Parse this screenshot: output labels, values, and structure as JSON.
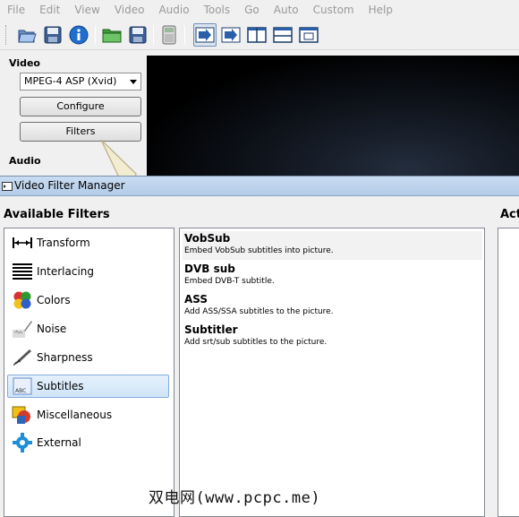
{
  "menu": [
    "File",
    "Edit",
    "View",
    "Video",
    "Audio",
    "Tools",
    "Go",
    "Auto",
    "Custom",
    "Help"
  ],
  "toolbar": {
    "icons": [
      "open-file-icon",
      "save-icon",
      "info-icon",
      "open-folder-icon",
      "save-as-icon",
      "calculator-icon",
      "play-filtered-icon",
      "next-frame-icon",
      "split-vertical-icon",
      "split-horizontal-icon",
      "single-view-icon"
    ],
    "pressed": "play-filtered-icon"
  },
  "left_panel": {
    "video_label": "Video",
    "codec_value": "MPEG-4 ASP (Xvid)",
    "configure_label": "Configure",
    "filters_label": "Filters",
    "audio_label": "Audio"
  },
  "dialog": {
    "title": "Video Filter Manager",
    "available_label": "Available Filters",
    "active_label": "Acti",
    "categories": [
      {
        "label": "Transform",
        "icon": "transform-icon"
      },
      {
        "label": "Interlacing",
        "icon": "interlacing-icon"
      },
      {
        "label": "Colors",
        "icon": "colors-icon"
      },
      {
        "label": "Noise",
        "icon": "noise-icon"
      },
      {
        "label": "Sharpness",
        "icon": "sharpness-icon"
      },
      {
        "label": "Subtitles",
        "icon": "subtitles-icon"
      },
      {
        "label": "Miscellaneous",
        "icon": "miscellaneous-icon"
      },
      {
        "label": "External",
        "icon": "external-icon"
      }
    ],
    "selected_category": "Subtitles",
    "filters": [
      {
        "name": "VobSub",
        "desc": "Embed VobSub subtitles into picture."
      },
      {
        "name": "DVB sub",
        "desc": "Embed DVB-T subtitle."
      },
      {
        "name": "ASS",
        "desc": "Add ASS/SSA subtitles to the picture."
      },
      {
        "name": "Subtitler",
        "desc": "Add srt/sub subtitles to the picture."
      }
    ]
  },
  "watermark": "双电网(www.pcpc.me)",
  "colors": {
    "title_bar": "#c9dcf1",
    "selection": "#cfe5f8",
    "selection_border": "#84acdd"
  }
}
